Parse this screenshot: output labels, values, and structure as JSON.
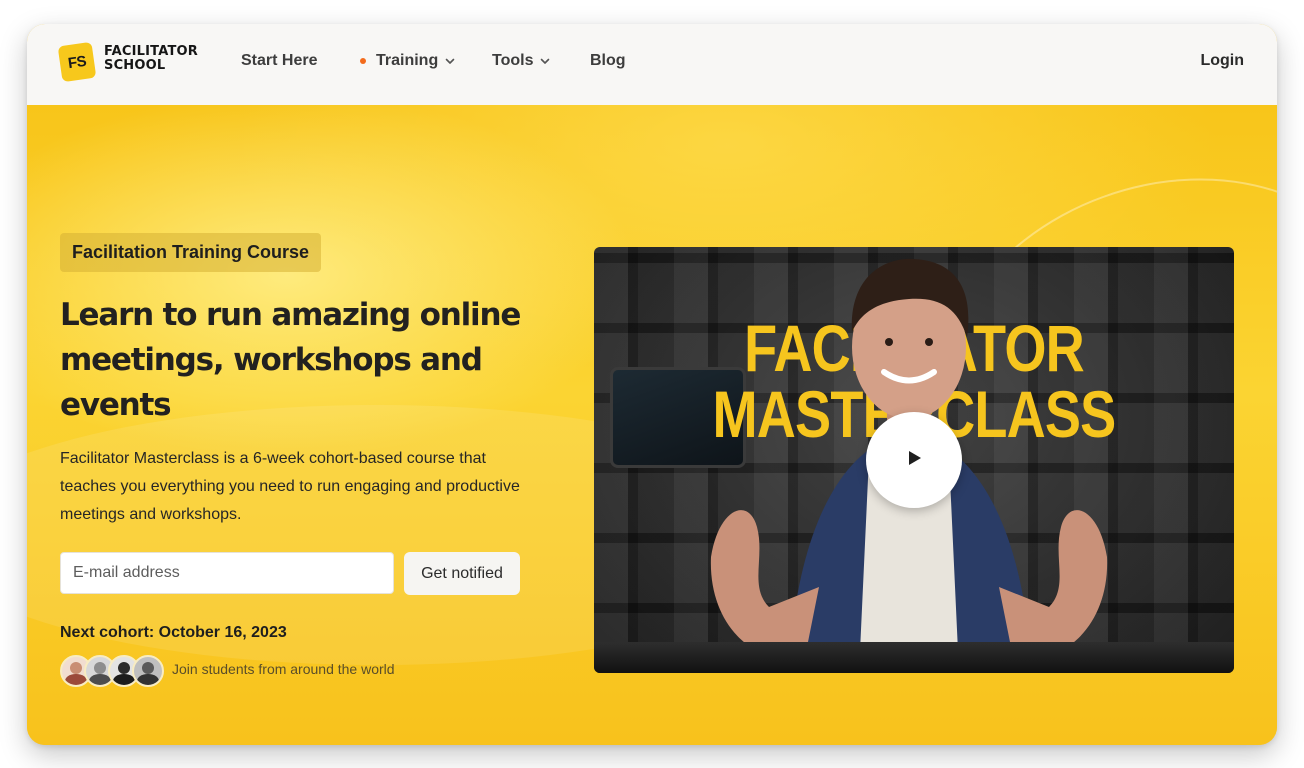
{
  "nav": {
    "logo_mark": "FS",
    "logo_line1": "FACILITATOR",
    "logo_line2": "SCHOOL",
    "items": [
      {
        "label": "Start Here"
      },
      {
        "label": "Training"
      },
      {
        "label": "Tools"
      },
      {
        "label": "Blog"
      }
    ],
    "login": "Login",
    "training_dot_color": "#f36b1c"
  },
  "hero": {
    "badge": "Facilitation Training Course",
    "headline": "Learn to run amazing online meetings, workshops and events",
    "description": "Facilitator Masterclass is a 6-week cohort-based course that teaches you everything you need to run engaging and productive meetings and workshops.",
    "email_placeholder": "E-mail address",
    "email_value": "",
    "cta": "Get notified",
    "cohort": "Next cohort: October 16, 2023",
    "join_text": "Join students from around the world",
    "accent_color": "#f9c623"
  },
  "video": {
    "title_line1": "FACILITATOR",
    "title_line2": "MASTERCLASS",
    "play_icon": "play-icon"
  }
}
